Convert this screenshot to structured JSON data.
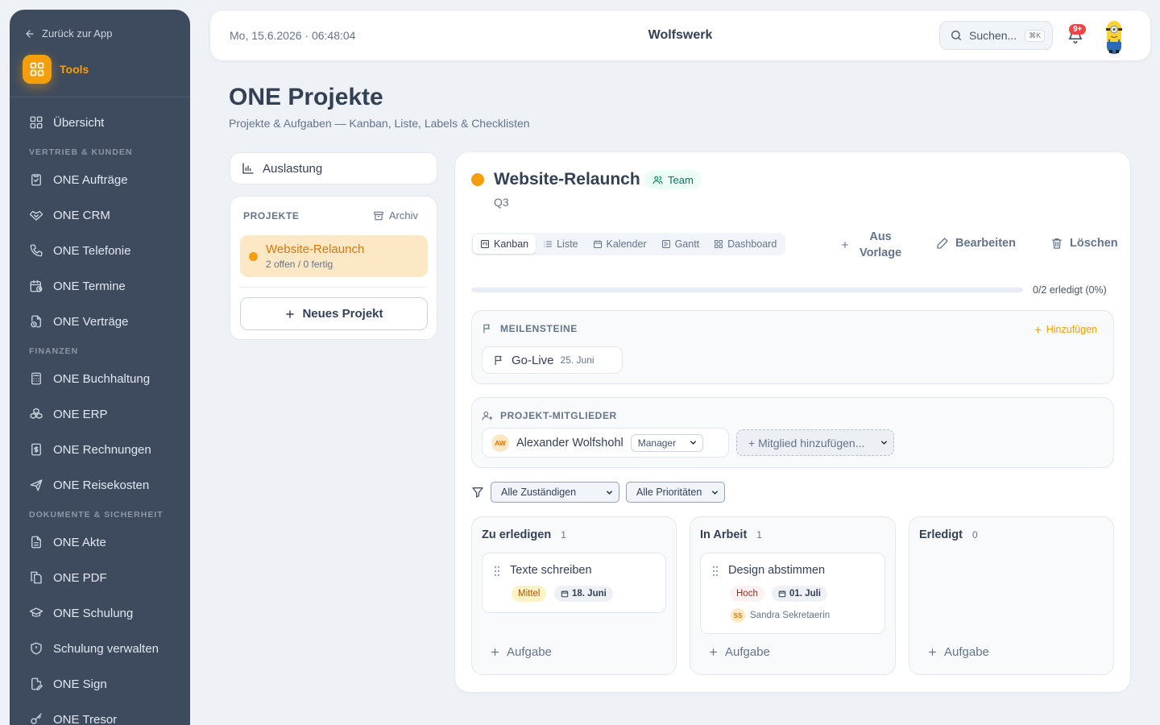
{
  "sidebar": {
    "back_label": "Zurück zur App",
    "app_label": "Tools",
    "overview": "Übersicht",
    "sections": {
      "sales": "VERTRIEB & KUNDEN",
      "finance": "FINANZEN",
      "docs": "DOKUMENTE & SICHERHEIT"
    },
    "sales_items": [
      "ONE Aufträge",
      "ONE CRM",
      "ONE Telefonie",
      "ONE Termine",
      "ONE Verträge"
    ],
    "finance_items": [
      "ONE Buchhaltung",
      "ONE ERP",
      "ONE Rechnungen",
      "ONE Reisekosten"
    ],
    "docs_items": [
      "ONE Akte",
      "ONE PDF",
      "ONE Schulung",
      "Schulung verwalten",
      "ONE Sign",
      "ONE Tresor"
    ]
  },
  "topbar": {
    "datetime": "Mo, 15.6.2026 · 06:48:04",
    "brand": "Wolfswerk",
    "search_label": "Suchen...",
    "search_shortcut": "⌘K",
    "notification_count": "9+"
  },
  "page": {
    "title": "ONE Projekte",
    "subtitle": "Projekte & Aufgaben — Kanban, Liste, Labels & Checklisten"
  },
  "left": {
    "utilization_label": "Auslastung",
    "projects_heading": "PROJEKTE",
    "archive_label": "Archiv",
    "projects": [
      {
        "name": "Website-Relaunch",
        "meta": "2 offen / 0 fertig",
        "color": "#f59e0b"
      }
    ],
    "new_project_label": "Neues Projekt"
  },
  "project": {
    "name": "Website-Relaunch",
    "visibility": "Team",
    "subtitle": "Q3",
    "views": [
      "Kanban",
      "Liste",
      "Kalender",
      "Gantt",
      "Dashboard"
    ],
    "active_view": "Kanban",
    "from_template_line1": "Aus",
    "from_template_line2": "Vorlage",
    "edit_label": "Bearbeiten",
    "delete_label": "Löschen",
    "progress_fraction": 0,
    "progress_text": "0/2 erledigt (0%)",
    "milestones_heading": "MEILENSTEINE",
    "add_milestone_label": "Hinzufügen",
    "milestones": [
      {
        "name": "Go-Live",
        "date": "25. Juni"
      }
    ],
    "members_heading": "PROJEKT-MITGLIEDER",
    "members": [
      {
        "initials": "AW",
        "name": "Alexander Wolfshohl",
        "role": "Manager"
      }
    ],
    "add_member_label": "+ Mitglied hinzufügen...",
    "filters": {
      "assignee": "Alle Zuständigen",
      "priority": "Alle Prioritäten"
    },
    "columns": [
      {
        "title": "Zu erledigen",
        "count": "1",
        "tasks": [
          {
            "title": "Texte schreiben",
            "priority": "Mittel",
            "due": "18. Juni"
          }
        ]
      },
      {
        "title": "In Arbeit",
        "count": "1",
        "tasks": [
          {
            "title": "Design abstimmen",
            "priority": "Hoch",
            "due": "01. Juli",
            "assignee_initials": "SS",
            "assignee": "Sandra Sekretaerin"
          }
        ]
      },
      {
        "title": "Erledigt",
        "count": "0",
        "tasks": []
      }
    ],
    "add_task_label": "Aufgabe"
  },
  "colors": {
    "accent": "#f59e0b",
    "sidebar": "#3e4b5e",
    "team_green": "#047857",
    "danger": "#ef4444"
  }
}
